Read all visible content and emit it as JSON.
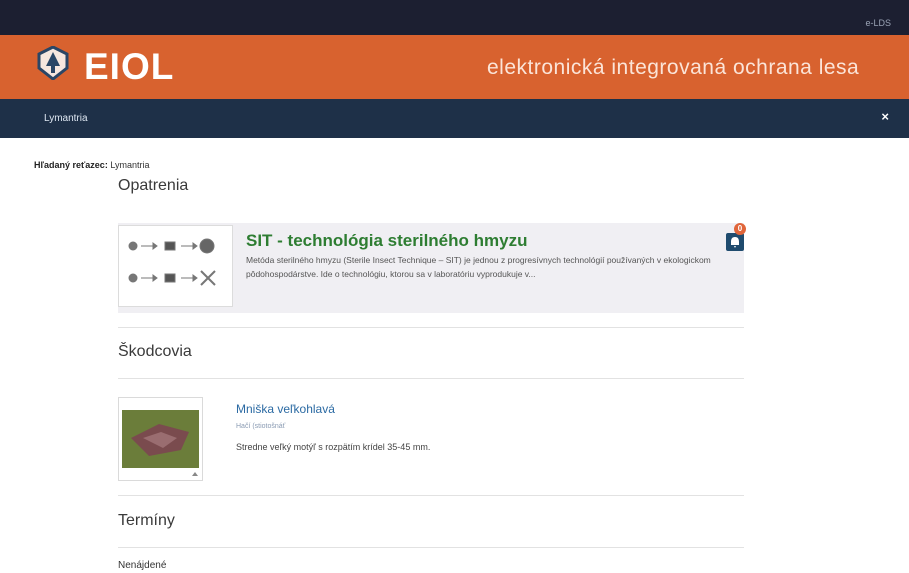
{
  "top_bar": {
    "link": "e-LDS"
  },
  "header": {
    "brand": "EIOL",
    "tagline": "elektronická integrovaná ochrana lesa"
  },
  "nav": {
    "item": "Lymantria",
    "close": "×"
  },
  "search": {
    "label": "Hľadaný reťazec:",
    "query": "Lymantria"
  },
  "sections": {
    "measures": {
      "title": "Opatrenia",
      "item": {
        "title": "SIT - technológia sterilného hmyzu",
        "text": "Metóda sterilného hmyzu (Sterile Insect Technique – SIT) je jednou z progresívnych technológií používaných v ekologickom pôdohospodárstve. Ide o technológiu, ktorou sa v laboratóriu vyprodukuje v...",
        "badge": "0"
      }
    },
    "pests": {
      "title": "Škodcovia",
      "item": {
        "title": "Mniška veľkohlavá",
        "latin": "Hačí (stiotošnáť",
        "description": "Stredne veľký motýľ s rozpätím krídel 35-45 mm."
      }
    },
    "terms": {
      "title": "Termíny",
      "item": "Nenájdené"
    }
  }
}
